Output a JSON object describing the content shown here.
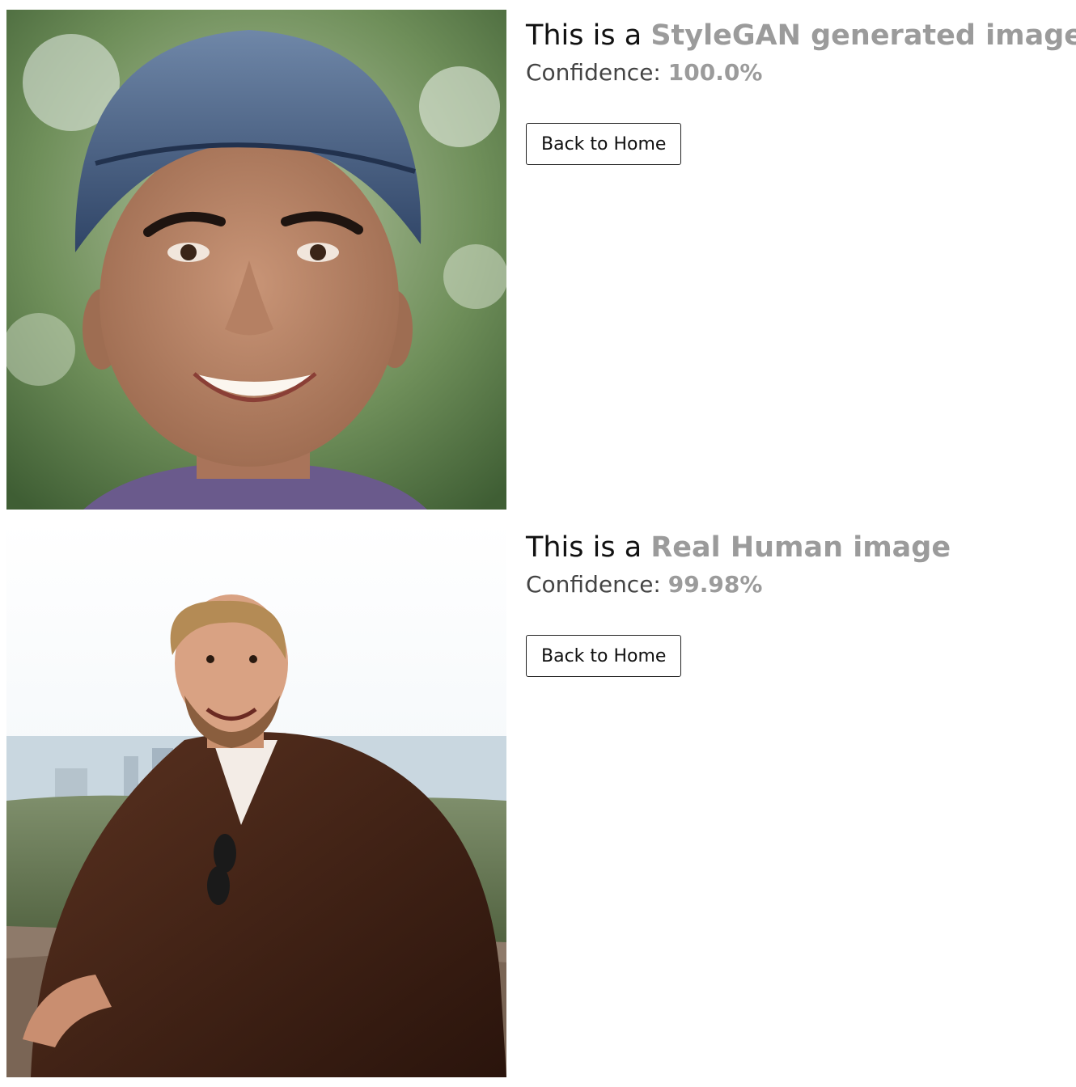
{
  "results": [
    {
      "headline_prefix": "This is a",
      "verdict": "StyleGAN generated image",
      "confidence_label": "Confidence:",
      "confidence_value": "100.0%",
      "button_label": "Back to Home"
    },
    {
      "headline_prefix": "This is a",
      "verdict": "Real Human image",
      "confidence_label": "Confidence:",
      "confidence_value": "99.98%",
      "button_label": "Back to Home"
    }
  ],
  "colors": {
    "verdict": "#9b9b9b",
    "text": "#111111",
    "button_border": "#222222"
  }
}
